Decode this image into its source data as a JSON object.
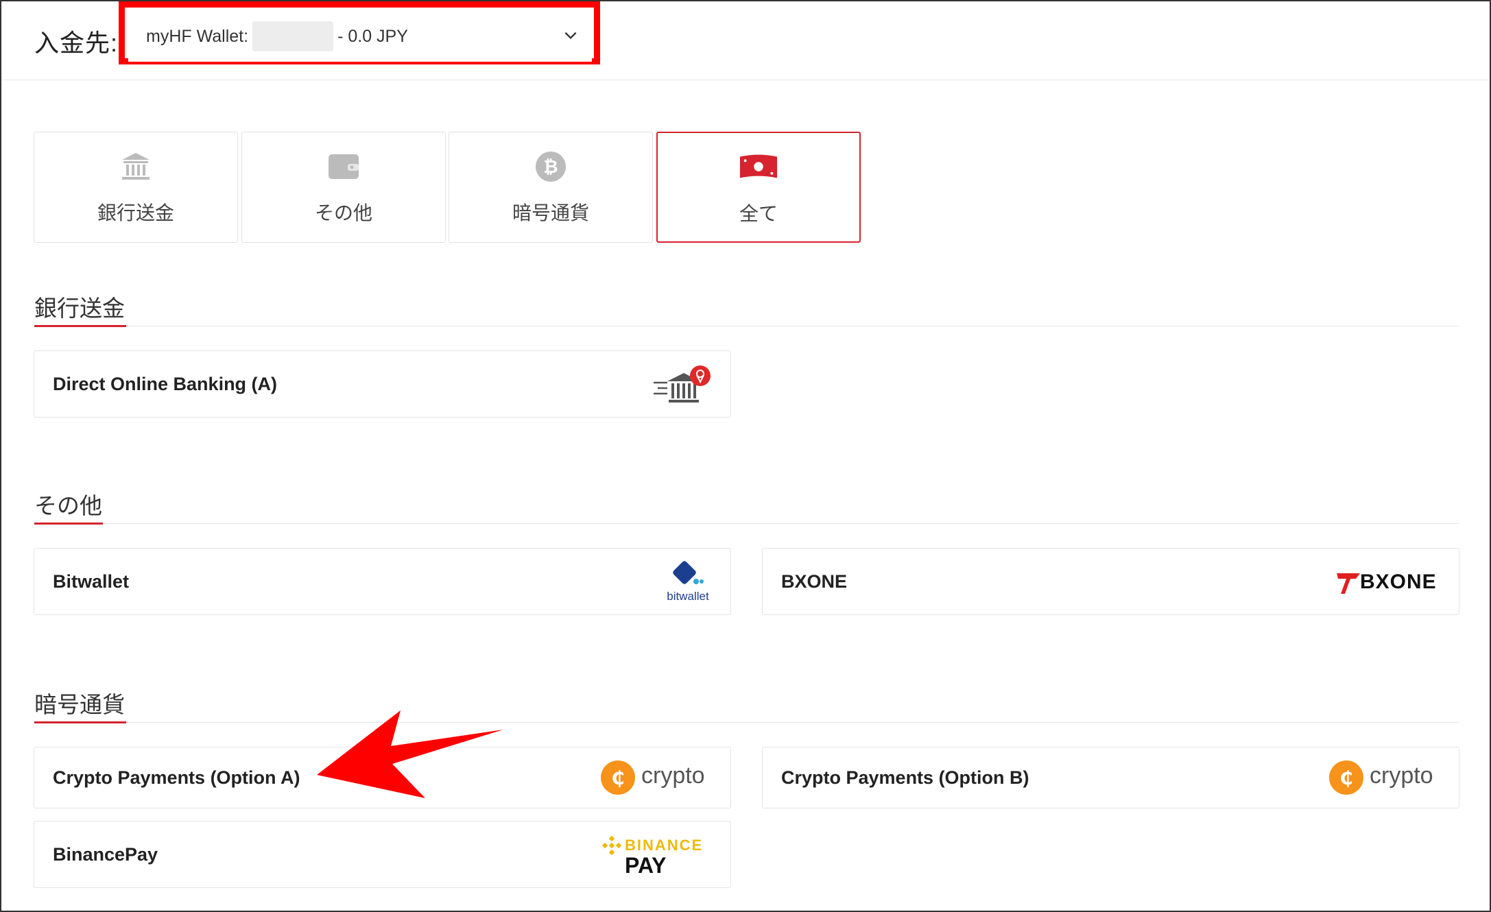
{
  "header": {
    "label": "入金先:",
    "select_prefix": "myHF Wallet:",
    "select_suffix": "- 0.0 JPY"
  },
  "tabs": [
    {
      "label": "銀行送金",
      "icon": "bank-icon"
    },
    {
      "label": "その他",
      "icon": "wallet-icon"
    },
    {
      "label": "暗号通貨",
      "icon": "bitcoin-icon"
    },
    {
      "label": "全て",
      "icon": "cash-icon",
      "active": true
    }
  ],
  "sections": {
    "bank": {
      "title": "銀行送金",
      "items": [
        {
          "name": "Direct Online Banking (A)",
          "logo": "bank-transfer-icon"
        }
      ]
    },
    "other": {
      "title": "その他",
      "items": [
        {
          "name": "Bitwallet",
          "logo_text": "bitwallet"
        },
        {
          "name": "BXONE",
          "logo_text": "BXONE"
        }
      ]
    },
    "crypto": {
      "title": "暗号通貨",
      "items": [
        {
          "name": "Crypto Payments (Option A)",
          "logo_text": "crypto"
        },
        {
          "name": "Crypto Payments (Option B)",
          "logo_text": "crypto"
        },
        {
          "name": "BinancePay",
          "logo_text_top": "BINANCE",
          "logo_text_bottom": "PAY"
        }
      ]
    }
  },
  "colors": {
    "accent": "#d6232f",
    "highlight": "#ff0000",
    "crypto_orange": "#f7931a",
    "binance_yellow": "#f0b90b"
  }
}
